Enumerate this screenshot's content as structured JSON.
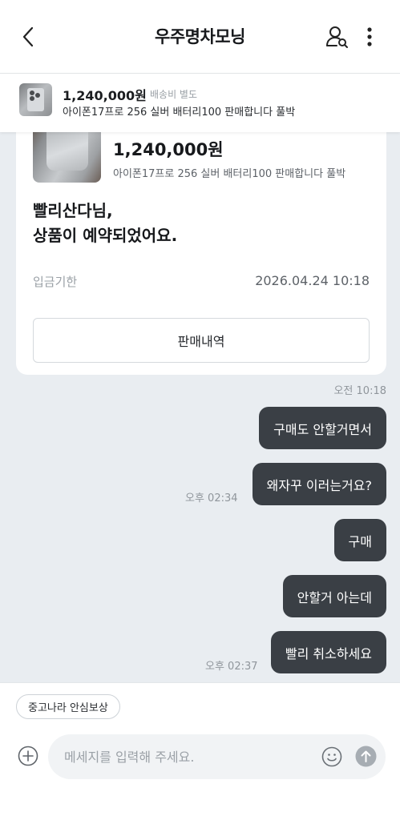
{
  "header": {
    "title": "우주명차모닝"
  },
  "product_bar": {
    "price": "1,240,000원",
    "shipping": "배송비 별도",
    "name": "아이폰17프로 256 실버 배터리100 판매합니다 풀박"
  },
  "card": {
    "price": "1,240,000원",
    "name": "아이폰17프로 256 실버 배터리100 판매합니다 풀박",
    "message": "빨리산다님,\n상품이 예약되었어요.",
    "deadline_label": "입금기한",
    "deadline_value": "2026.04.24 10:18",
    "button_label": "판매내역",
    "time": "오전 10:18"
  },
  "messages": [
    {
      "text": "구매도 안할거면서",
      "time": ""
    },
    {
      "text": "왜자꾸 이러는거요?",
      "time": "오후 02:34"
    },
    {
      "text": "구매",
      "time": ""
    },
    {
      "text": "안할거 아는데",
      "time": ""
    },
    {
      "text": "빨리 취소하세요",
      "time": "오후 02:37"
    }
  ],
  "bottom": {
    "chip_label": "중고나라 안심보상",
    "input_placeholder": "메세지를 입력해 주세요."
  },
  "colors": {
    "bubble": "#3a3f45",
    "background": "#e9edf1",
    "accent_gray": "#9aa0a6"
  }
}
